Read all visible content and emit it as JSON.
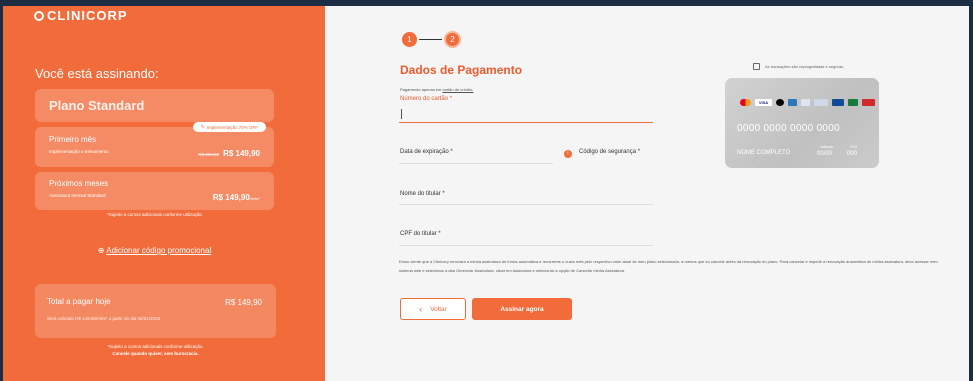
{
  "brand": {
    "logo_text": "CLINICORP"
  },
  "summary": {
    "heading": "Você está assinando:",
    "plan_name": "Plano Standard",
    "first_month": {
      "badge": "Implementação 70% OFF",
      "title": "Primeiro mês",
      "subtitle": "Implementação e treinamento",
      "old_price": "R$ 499,00",
      "price": "R$ 149,90"
    },
    "next_months": {
      "title": "Próximos meses",
      "subtitle": "Assinatura mensal Standard",
      "price": "R$ 149,90",
      "period": "/mês*"
    },
    "usage_note": "*Sujeito a cursos adicionais conforme utilização",
    "promo_link": "Adicionar código promocional",
    "total": {
      "label": "Total a pagar hoje",
      "value": "R$ 149,90",
      "detail": "Será cobrado R$ 149,90/mês* a partir do dia 05/01/2025"
    },
    "footer_note_1": "*Sujeito a cursos adicionais conforme utilização.",
    "footer_note_2": "Cancele quando quiser, sem burocracia."
  },
  "steps": [
    "1",
    "2"
  ],
  "payment": {
    "title": "Dados de Pagamento",
    "subtitle_prefix": "Pagamento apenas em",
    "subtitle_link": "cartão de crédito.",
    "secure_note": "As transações são criptografadas e seguras.",
    "card_number_label": "Número do cartão *",
    "expiry_label": "Data de expiração *",
    "cvv_label": "Código de segurança *",
    "holder_label": "Nome do titular *",
    "cpf_label": "CPF do titular *",
    "terms": "Estou ciente que a Clinicorp renovará a minha assinatura de forma automática e recorrente o custo mês pelo respectivo valor atual de meu plano selecionado, a menos que eu cancele antes da renovação do plano. Para cancelar e impedir a renovação automática de minha assinatura, devo acessar meu sistema web e selecionar a aba Gerenciar Assinatura, clicar em Assinatura e selecionar a opção de Cancelar minha Assinatura.",
    "back_button": "Voltar",
    "submit_button": "Assinar agora"
  },
  "card_preview": {
    "brands": [
      "mastercard",
      "VISA",
      "elo",
      "amex",
      "diners",
      "hipercard",
      "JCB",
      "aura"
    ],
    "number": "0000 0000 0000 0000",
    "name": "NOME COMPLETO",
    "validity_label": "validade",
    "validity_value": "00/00",
    "cvv_label": "CVV",
    "cvv_value": "000"
  },
  "colors": {
    "accent": "#f26b3a",
    "panel_bg": "#f5f5f5"
  }
}
